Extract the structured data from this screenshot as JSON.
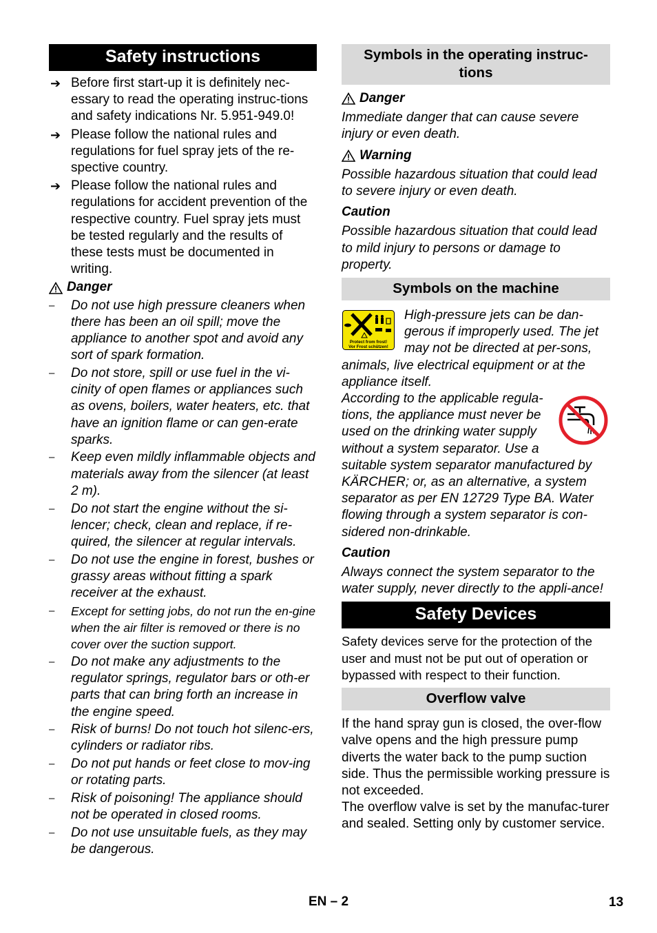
{
  "left": {
    "heading": "Safety instructions",
    "bullets": [
      "Before first start-up it is definitely nec-essary to read the operating instruc-tions and safety indications Nr. 5.951-949.0!",
      "Please follow the national rules and regulations for fuel spray jets of the re-spective country.",
      "Please follow the national rules and regulations for accident prevention of the respective country. Fuel spray jets must be tested regularly and the results of these tests must be documented in writing."
    ],
    "bullet_icon": "arrow-right-icon",
    "danger_label": "Danger",
    "danger_items": [
      "Do not use high pressure cleaners when there has been an oil spill; move the appliance to another spot and avoid any sort of spark formation.",
      "Do not store, spill or use fuel in the vi-cinity of open flames or appliances such as ovens, boilers, water heaters, etc. that have an ignition flame or can gen-erate sparks.",
      "Keep even mildly inflammable objects and materials away from the silencer (at least 2 m).",
      "Do not start the engine without the si-lencer; check, clean and replace, if re-quired, the silencer at regular intervals.",
      "Do not use the engine in forest, bushes or grassy areas without fitting a spark receiver at the exhaust.",
      "Except for setting jobs, do not run the en-gine when the air filter is removed or there is no cover over the suction support.",
      "Do not make any adjustments to the regulator springs, regulator bars or oth-er parts that can bring forth an increase in the engine speed.",
      "Risk of burns! Do not touch hot silenc-ers, cylinders or radiator ribs.",
      "Do not put hands or feet close to mov-ing or rotating parts.",
      "Risk of poisoning! The appliance should not be operated in closed rooms.",
      "Do not use unsuitable fuels, as they may be dangerous."
    ],
    "dash": "–"
  },
  "right": {
    "symbols_heading": "Symbols in the operating instruc-tions",
    "danger_label": "Danger",
    "danger_text": "Immediate danger that can cause severe injury or even death.",
    "warning_label": "Warning",
    "warning_text": "Possible hazardous situation that could lead to severe injury or even death.",
    "caution_label": "Caution",
    "caution_text": "Possible hazardous situation that could lead to mild injury to persons or damage to property.",
    "machine_heading": "Symbols on the machine",
    "machine_label_line1": "Protect from frost!",
    "machine_label_line2": "Vor Frost schützen!",
    "machine_text": "High-pressure jets can be dan-gerous if improperly used. The jet may not be directed at per-sons, animals, live electrical equipment or at the appliance itself.",
    "water_text": "According to the applicable regula-tions, the appliance must never be used on the drinking water supply without a system separator. Use a suitable system separator manufactured by KÄRCHER; or, as an alternative, a system separator as per EN 12729 Type BA. Water flowing through a system separator is con-sidered non-drinkable.",
    "caution2_label": "Caution",
    "caution2_text": "Always connect the system separator to the water supply, never directly to the appli-ance!",
    "devices_heading": "Safety Devices",
    "devices_text": "Safety devices serve for the protection of the user and must not be put out of operation or bypassed with respect to their function.",
    "overflow_heading": "Overflow valve",
    "overflow_text1": "If the hand spray gun is closed, the over-flow valve opens and the high pressure pump diverts the water back to the pump suction side.  Thus the permissible working pressure is not exceeded.",
    "overflow_text2": "The overflow valve is set by the manufac-turer and sealed. Setting only by customer service."
  },
  "footer": {
    "section": "EN – 2",
    "page": "13"
  },
  "colors": {
    "heading_black": "#000000",
    "heading_grey": "#d9d9d9",
    "symbol_yellow": "#f5e600",
    "prohibition_red": "#e3202a"
  }
}
